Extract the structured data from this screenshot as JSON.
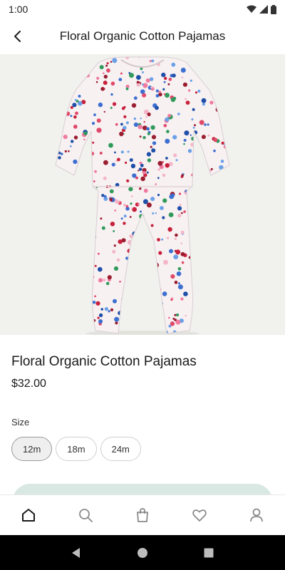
{
  "status_bar": {
    "time": "1:00"
  },
  "header": {
    "title": "Floral Organic Cotton Pajamas"
  },
  "product": {
    "name": "Floral Organic Cotton Pajamas",
    "price": "$32.00",
    "image_icon": "floral-pajamas-photo",
    "carousel_progress": 0.33
  },
  "size_selector": {
    "label": "Size",
    "options": [
      "12m",
      "18m",
      "24m"
    ],
    "selected": "12m"
  },
  "bottom_nav": {
    "items": [
      "home-icon",
      "search-icon",
      "bag-icon",
      "heart-icon",
      "profile-icon"
    ],
    "active": "home-icon"
  },
  "colors": {
    "accent_button": "#d9e8e3",
    "hero_background": "#f1f1ee",
    "text": "#1a1a1a"
  }
}
